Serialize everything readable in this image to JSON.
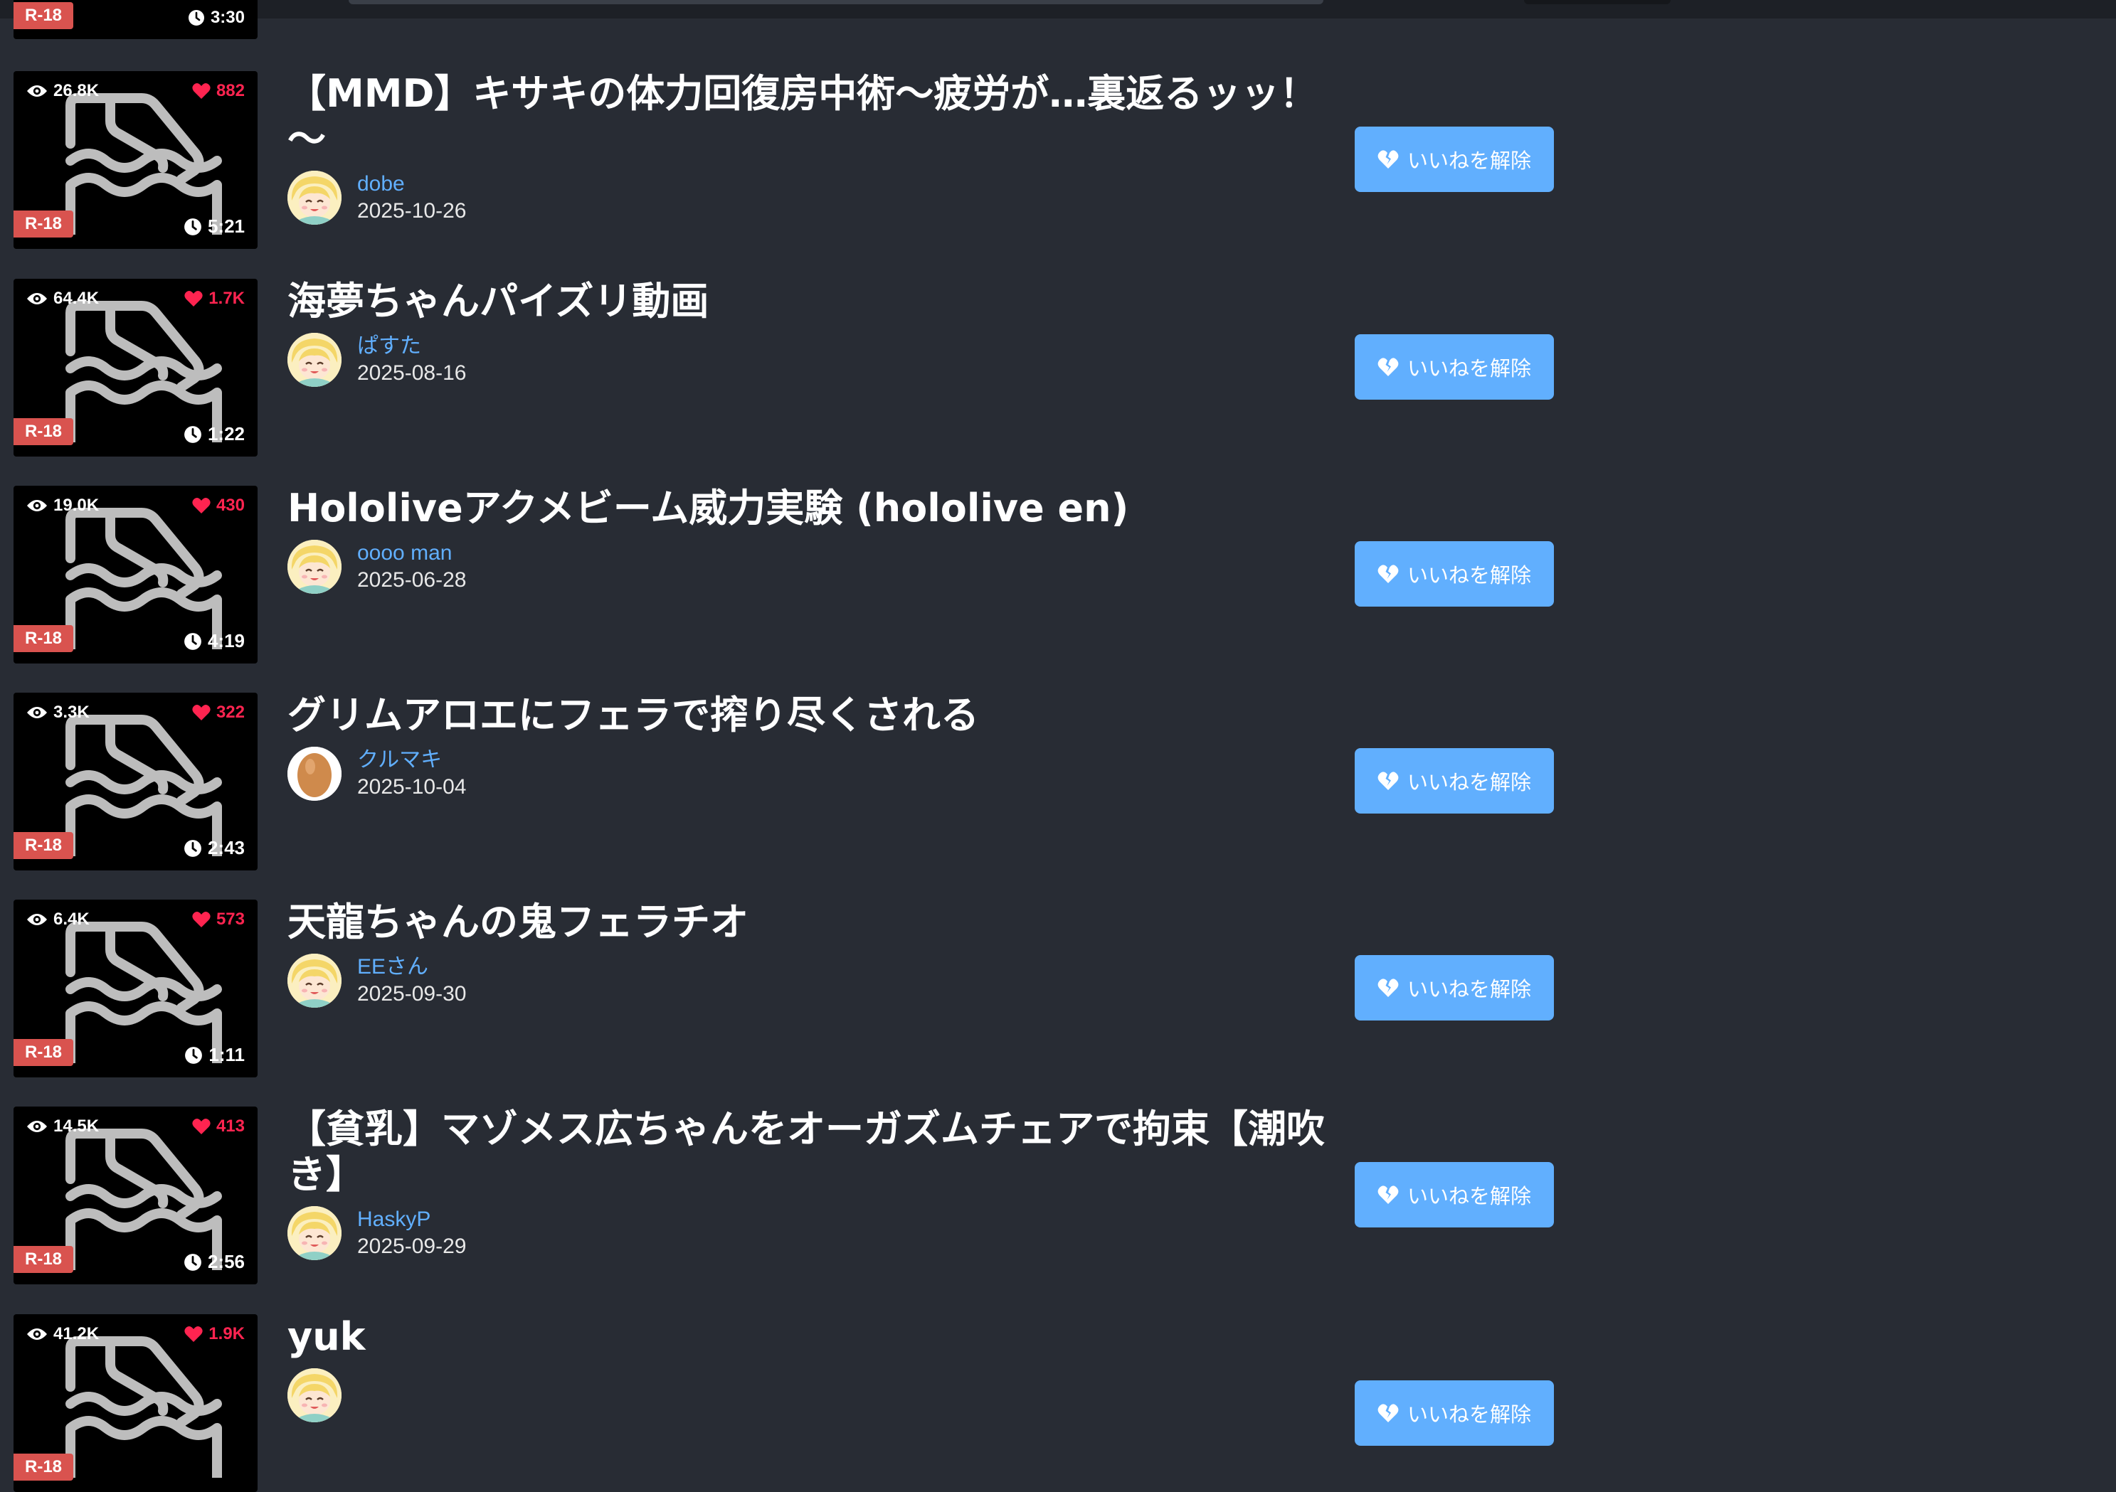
{
  "partial_top_item": {
    "badge": "R-18",
    "duration": "3:30"
  },
  "badge_label": "R-18",
  "unlike_button_label": "いいねを解除",
  "colors": {
    "background": "#282c34",
    "accent_blue": "#61affe",
    "like_red": "#ff2450",
    "r18_badge": "#d9534f"
  },
  "icons": {
    "views": "eye-icon",
    "likes": "heart-icon",
    "duration": "clock-icon",
    "unlike": "broken-heart-icon",
    "thumbnail": "broken-image-placeholder-icon"
  },
  "videos": [
    {
      "views": "26.8K",
      "likes": "882",
      "duration": "5:21",
      "title": "【MMD】キサキの体力回復房中術～疲労が…裏返るッッ！～",
      "author": "dobe",
      "date": "2025-10-26",
      "avatar": "anime-avatar"
    },
    {
      "views": "64.4K",
      "likes": "1.7K",
      "duration": "1:22",
      "title": "海夢ちゃんパイズリ動画",
      "author": "ぱすた",
      "date": "2025-08-16",
      "avatar": "anime-avatar"
    },
    {
      "views": "19.0K",
      "likes": "430",
      "duration": "4:19",
      "title": "Hololiveアクメビーム威力実験 (hololive en)",
      "author": "oooo man",
      "date": "2025-06-28",
      "avatar": "anime-avatar"
    },
    {
      "views": "3.3K",
      "likes": "322",
      "duration": "2:43",
      "title": "グリムアロエにフェラで搾り尽くされる",
      "author": "クルマキ",
      "date": "2025-10-04",
      "avatar": "egg-avatar"
    },
    {
      "views": "6.4K",
      "likes": "573",
      "duration": "1:11",
      "title": "天龍ちゃんの鬼フェラチオ",
      "author": "EEさん",
      "date": "2025-09-30",
      "avatar": "anime-avatar"
    },
    {
      "views": "14.5K",
      "likes": "413",
      "duration": "2:56",
      "title": "【貧乳】マゾメス広ちゃんをオーガズムチェアで拘束【潮吹き】",
      "author": "HaskyP",
      "date": "2025-09-29",
      "avatar": "anime-avatar"
    },
    {
      "views": "41.2K",
      "likes": "1.9K",
      "duration": "",
      "title": "yuk",
      "author": "",
      "date": "",
      "avatar": "anime-avatar"
    }
  ]
}
